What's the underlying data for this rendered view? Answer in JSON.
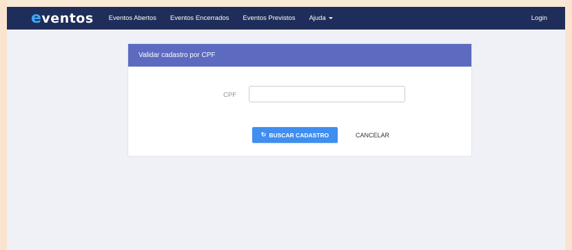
{
  "navbar": {
    "brand_e": "e",
    "brand_rest": "ventos",
    "links": [
      {
        "label": "Eventos Abertos"
      },
      {
        "label": "Eventos Encerrados"
      },
      {
        "label": "Eventos Previstos"
      },
      {
        "label": "Ajuda"
      }
    ],
    "login_label": "Login"
  },
  "panel": {
    "title": "Validar cadastro por CPF",
    "cpf_label": "CPF",
    "cpf_value": "",
    "cpf_placeholder": "",
    "search_button_icon": "refresh-icon",
    "search_button_label": "BUSCAR CADASTRO",
    "cancel_button_label": "CANCELAR"
  },
  "colors": {
    "navbar_bg": "#1f2d5a",
    "panel_header_bg": "#5c6bc0",
    "primary_button": "#3f8ef0",
    "page_bg": "#f0f1f6",
    "brand_accent": "#3fa9f5"
  }
}
